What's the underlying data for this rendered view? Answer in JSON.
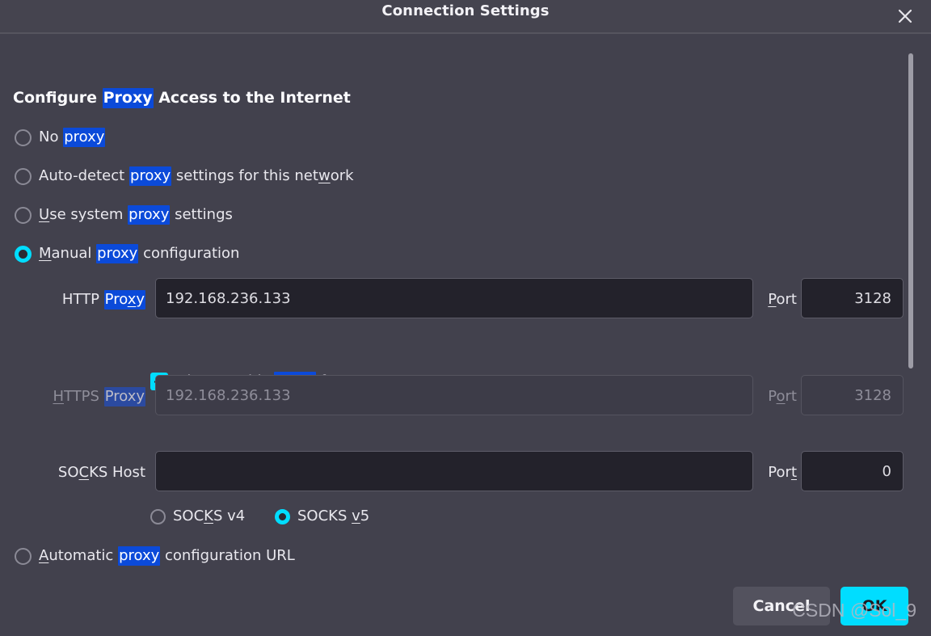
{
  "window": {
    "title": "Connection Settings",
    "close_icon": "close-x-icon"
  },
  "colors": {
    "accent": "#00ddff",
    "dialog_bg": "#42414d",
    "titlebar_bg": "#45444f",
    "input_bg": "#23222b",
    "text": "#e9e8ee",
    "disabled_text": "#8e8d99",
    "highlight_bg": "#0b4ad9",
    "highlight_text": "#ffffff",
    "ok_button_bg": "#00ddff",
    "ok_button_text": "#1c1b22",
    "cancel_button_bg": "#53525e"
  },
  "heading": {
    "before": "Configure ",
    "match": "Proxy",
    "after": " Access to the Internet"
  },
  "proxy_mode": {
    "selected": "manual",
    "options": [
      {
        "id": "no-proxy",
        "checked": false,
        "before": "No ",
        "match": "proxy",
        "after": ""
      },
      {
        "id": "auto-detect",
        "checked": false,
        "before": "Auto-detect ",
        "match": "proxy",
        "after_pre": " settings for this net",
        "accel": "w",
        "after_post": "ork"
      },
      {
        "id": "use-system",
        "checked": false,
        "accel": "U",
        "before_post": "se system ",
        "match": "proxy",
        "after": " settings"
      },
      {
        "id": "manual",
        "checked": true,
        "accel": "M",
        "before_post": "anual ",
        "match": "proxy",
        "after": " configuration"
      },
      {
        "id": "auto-url",
        "checked": false,
        "accel": "A",
        "before_post": "utomatic ",
        "match": "proxy",
        "after": " configuration URL"
      }
    ]
  },
  "http_proxy": {
    "label_pre": "HTTP ",
    "label_match_pre": "Pro",
    "label_match_accel": "x",
    "label_match_post": "y",
    "value": "192.168.236.133",
    "port_label_accel": "P",
    "port_label_rest": "ort",
    "port_value": "3128",
    "disabled": false
  },
  "https_checkbox": {
    "checked": true,
    "icon": "check-icon",
    "pre": "Al",
    "accel": "s",
    "mid": "o use this ",
    "match": "proxy",
    "post": " for HTTPS"
  },
  "https_proxy": {
    "label_accel": "H",
    "label_rest": "TTPS ",
    "label_match": "Proxy",
    "value": "192.168.236.133",
    "port_label_pre": "P",
    "port_label_accel": "o",
    "port_label_post": "rt",
    "port_value": "3128",
    "disabled": true
  },
  "socks": {
    "label_pre": "SO",
    "label_accel": "C",
    "label_post": "KS Host",
    "value": "",
    "port_label_pre": "Por",
    "port_label_accel": "t",
    "port_value": "0",
    "versions": [
      {
        "id": "socks-v4",
        "checked": false,
        "pre": "SOC",
        "accel": "K",
        "post": "S v4"
      },
      {
        "id": "socks-v5",
        "checked": true,
        "pre": "SOCKS ",
        "accel": "v",
        "post": "5"
      }
    ],
    "selected": "socks-v5"
  },
  "auto_config_url": {
    "value": ""
  },
  "footer": {
    "cancel_label": "Cancel",
    "ok_label": "OK"
  },
  "watermark": {
    "text": "CSDN @Sol_9"
  }
}
